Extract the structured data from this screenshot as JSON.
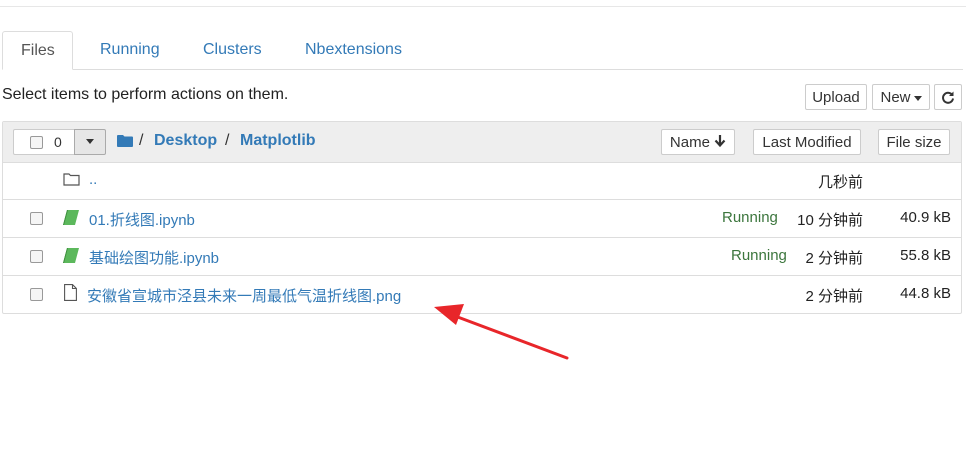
{
  "tabs": [
    {
      "label": "Files",
      "active": true
    },
    {
      "label": "Running",
      "active": false
    },
    {
      "label": "Clusters",
      "active": false
    },
    {
      "label": "Nbextensions",
      "active": false
    }
  ],
  "hint_text": "Select items to perform actions on them.",
  "toolbar": {
    "upload_label": "Upload",
    "new_label": "New",
    "refresh_icon": "refresh-icon"
  },
  "header": {
    "selected_count": "0",
    "breadcrumb": [
      "Desktop",
      "Matplotlib"
    ],
    "sort_name_label": "Name",
    "sort_modified_label": "Last Modified",
    "sort_size_label": "File size"
  },
  "rows": [
    {
      "name": "..",
      "type": "folder",
      "running": "",
      "modified": "几秒前",
      "size": ""
    },
    {
      "name": "01.折线图.ipynb",
      "type": "notebook",
      "running": "Running",
      "modified": "10 分钟前",
      "size": "40.9 kB"
    },
    {
      "name": "基础绘图功能.ipynb",
      "type": "notebook",
      "running": "Running",
      "modified": "2 分钟前",
      "size": "55.8 kB"
    },
    {
      "name": "安徽省宣城市泾县未来一周最低气温折线图.png",
      "type": "file",
      "running": "",
      "modified": "2 分钟前",
      "size": "44.8 kB"
    }
  ],
  "colors": {
    "link": "#337ab7",
    "running": "#3c763d",
    "arrow": "#e8262a"
  }
}
